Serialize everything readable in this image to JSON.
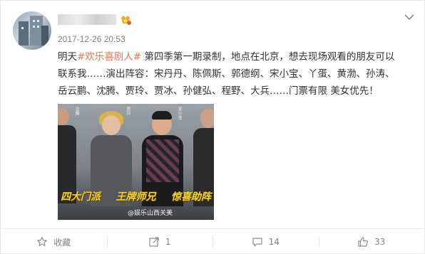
{
  "post": {
    "username": "",
    "timestamp": "2017-12-26 20:53",
    "text_before": "明天",
    "hashtag": "#欢乐喜剧人#",
    "text_after": " 第四季第一期录制，地点在北京，想去现场观看的朋友可以联系我……演出阵容：宋丹丹、陈佩斯、郭德纲、宋小宝、丫蛋、黄渤、孙涛、岳云鹏、沈腾、贾玲、贾冰、孙健弘、程野、大兵……门票有限 美女优先！"
  },
  "image": {
    "banner_words": [
      "四大门派",
      "王牌师兄",
      "惊喜助阵"
    ],
    "name_tags": [
      "沈腾",
      "贾玲",
      "宋小宝"
    ],
    "watermark": "@娱乐山西关美"
  },
  "actions": {
    "favorite_label": "收藏",
    "repost_count": "1",
    "comment_count": "14",
    "like_count": "33"
  },
  "icons": {
    "chevron": "chevron-down-icon",
    "favorite": "star-icon",
    "repost": "share-icon",
    "comment": "comment-icon",
    "like": "thumbs-up-icon"
  },
  "colors": {
    "hashtag": "#eb7350",
    "meta_text": "#808080",
    "body_text": "#333333",
    "banner": "#f3d52a"
  }
}
